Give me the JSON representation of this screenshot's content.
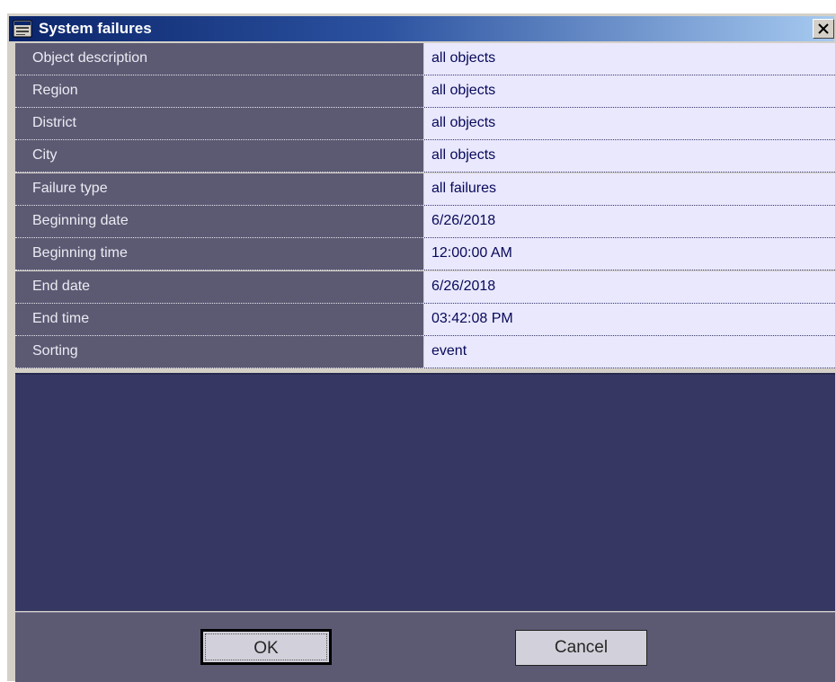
{
  "window": {
    "title": "System failures",
    "icon": "window-app-icon",
    "close_glyph": "×"
  },
  "properties": [
    {
      "label": "Object description",
      "value": "all objects"
    },
    {
      "label": "Region",
      "value": "all objects"
    },
    {
      "label": "District",
      "value": "all objects"
    },
    {
      "label": "City",
      "value": "all objects"
    },
    {
      "label": "Failure type",
      "value": "all failures"
    },
    {
      "label": "Beginning date",
      "value": "6/26/2018"
    },
    {
      "label": "Beginning time",
      "value": "12:00:00 AM"
    },
    {
      "label": "End date",
      "value": "6/26/2018"
    },
    {
      "label": "End time",
      "value": "03:42:08 PM"
    },
    {
      "label": "Sorting",
      "value": "event"
    }
  ],
  "buttons": {
    "ok_label": "OK",
    "cancel_label": "Cancel"
  },
  "colors": {
    "label_bg": "#5c5a73",
    "value_bg": "#e9e8fd",
    "empty_area_bg": "#363763",
    "titlebar_start": "#0a246a",
    "titlebar_end": "#a6caf0"
  }
}
